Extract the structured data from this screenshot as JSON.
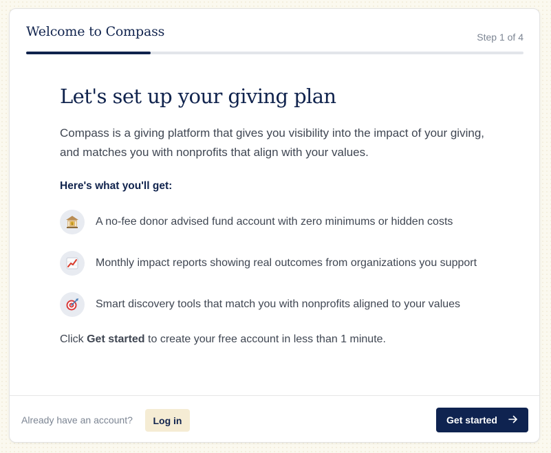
{
  "header": {
    "title": "Welcome to Compass",
    "step": "Step 1 of 4",
    "progress": 0.25
  },
  "main": {
    "headline": "Let's set up your giving plan",
    "intro": "Compass is a giving platform that gives you visibility into the impact of your giving, and matches you with nonprofits that align with your values.",
    "subhead": "Here's what you'll get:",
    "features": [
      {
        "icon": "bank-icon",
        "text": "A no-fee donor advised fund account with zero minimums or hidden costs"
      },
      {
        "icon": "chart-increasing-icon",
        "text": "Monthly impact reports showing real outcomes from organizations you support"
      },
      {
        "icon": "target-icon",
        "text": "Smart discovery tools that match you with nonprofits aligned to your values"
      }
    ],
    "cta_prefix": "Click ",
    "cta_bold": "Get started",
    "cta_suffix": " to create your free account in less than 1 minute."
  },
  "footer": {
    "prompt": "Already have an account?",
    "login_label": "Log in",
    "start_label": "Get started",
    "start_icon": "arrow-right-icon"
  },
  "colors": {
    "brand": "#10234d",
    "login_bg": "#f5ecd4",
    "page_bg": "#fbf9ef"
  }
}
